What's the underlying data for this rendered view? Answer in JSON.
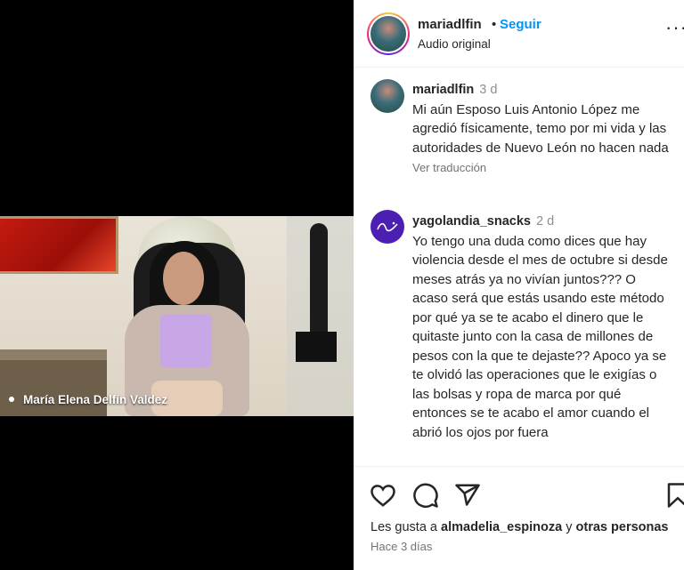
{
  "video": {
    "caption": "María Elena Delfín Valdez"
  },
  "header": {
    "username": "mariadlfin",
    "separator": "•",
    "follow_label": "Seguir",
    "audio_label": "Audio original",
    "more_glyph": "···"
  },
  "comments": [
    {
      "username": "mariadlfin",
      "time": "3 d",
      "text": "Mi aún Esposo Luis Antonio López me agredió físicamente, temo por mi vida y las autoridades de Nuevo León no hacen nada",
      "translate_label": "Ver traducción"
    },
    {
      "username": "yagolandia_snacks",
      "time": "2 d",
      "text": "Yo tengo una duda como dices que hay violencia desde el mes de octubre si desde meses atrás ya no vivían juntos??? O acaso será que estás usando este método por qué ya se te acabo el dinero que le quitaste junto con la casa de millones de pesos con la que te dejaste?? Apoco ya se te olvidó las operaciones que le exigías o las bolsas y ropa de marca por qué entonces se te acabo el amor cuando el abrió los ojos por fuera"
    }
  ],
  "actions": {
    "likes_prefix": "Les gusta a",
    "likes_user": "almadelia_espinoza",
    "likes_conj": "y",
    "likes_others": "otras personas",
    "time_ago": "Hace 3 días"
  },
  "colors": {
    "follow": "#0095f6",
    "muted": "#737373",
    "text": "#262626"
  }
}
